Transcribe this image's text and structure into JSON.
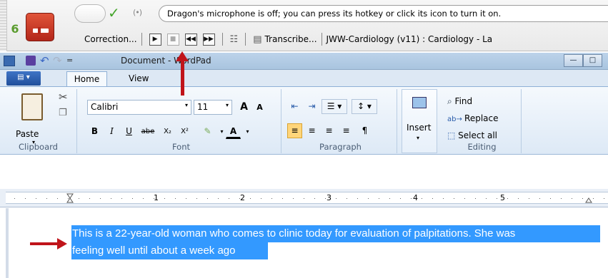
{
  "dragon": {
    "status_message": "Dragon's microphone is off; you can press its hotkey or click its icon to turn it on.",
    "logo_glyph": "6",
    "correction_label": "Correction...",
    "transcribe_label": "Transcribe...",
    "profile_label": "JWW-Cardiology (v11) : Cardiology - La",
    "check_glyph": "✓",
    "radio_glyph": "(•)",
    "buttons": [
      "play",
      "stop",
      "skip-back",
      "skip-forward"
    ]
  },
  "wordpad": {
    "title": "Document - WordPad",
    "qa_dropdown_glyph": "=",
    "tabs": {
      "home": "Home",
      "view": "View"
    },
    "clipboard": {
      "paste": "Paste",
      "group": "Clipboard"
    },
    "font": {
      "family": "Calibri",
      "size": "11",
      "group": "Font",
      "bold": "B",
      "italic": "I",
      "underline": "U",
      "strike": "abe",
      "subscript": "X₂",
      "superscript": "X²",
      "grow": "A",
      "shrink": "A",
      "color_letter": "A"
    },
    "paragraph": {
      "group": "Paragraph"
    },
    "insert": {
      "label": "Insert"
    },
    "editing": {
      "find": "Find",
      "replace": "Replace",
      "select_all": "Select all",
      "group": "Editing"
    },
    "ruler_numbers": [
      "1",
      "2",
      "3",
      "4",
      "5"
    ],
    "document_lines": [
      "This is a 22-year-old woman who comes to clinic today for evaluation of palpitations.  She was",
      "feeling well until about a week ago"
    ]
  },
  "colors": {
    "selection": "#3399ff",
    "annotation_arrow": "#c0141a",
    "mic_red": "#d0402a",
    "ribbon_bg": "#dde9f6"
  }
}
